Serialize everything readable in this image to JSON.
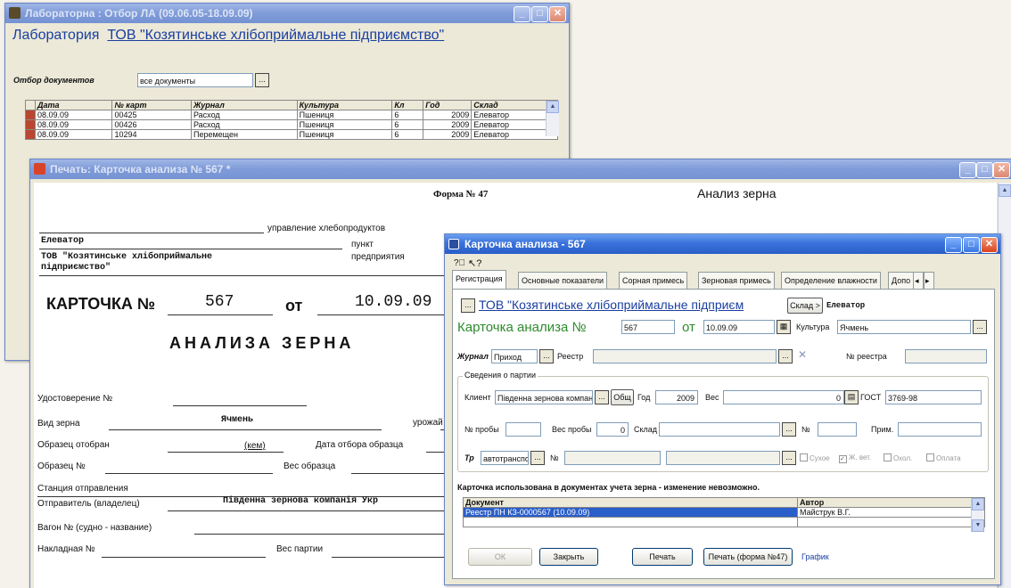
{
  "lab_window": {
    "title": "Лабораторна : Отбор ЛА (09.06.05-18.09.09)",
    "heading_prefix": "Лаборатория",
    "heading_company": "ТОВ \"Козятинське хлібоприймальне підприємство\"",
    "filter_label": "Отбор документов",
    "filter_value": "все документы",
    "table": {
      "columns": [
        "Дата",
        "№ карт",
        "Журнал",
        "Культура",
        "Кл",
        "Год",
        "Склад"
      ],
      "rows": [
        [
          "08.09.09",
          "00425",
          "Расход",
          "Пшениця",
          "6",
          "2009",
          "Елеватор"
        ],
        [
          "08.09.09",
          "00426",
          "Расход",
          "Пшениця",
          "6",
          "2009",
          "Елеватор"
        ],
        [
          "08.09.09",
          "10294",
          "Перемещен",
          "Пшениця",
          "6",
          "2009",
          "Елеватор"
        ]
      ]
    }
  },
  "print_window": {
    "title": "Печать: Карточка анализа № 567  *",
    "form_number": "Форма № 47",
    "form_title": "Анализ зерна",
    "upravlenie": "управление хлебопродуктов",
    "elevator": "Елеватор",
    "punkt": "пункт",
    "company": "ТОВ \"Козятинське хлібоприймальне підприємство\"",
    "predpriyatiya": "предприятия",
    "card_label": "КАРТОЧКА №",
    "card_number": "567",
    "ot": "от",
    "card_date": "10.09.09",
    "analysis_title": "АНАЛИЗА   ЗЕРНА",
    "udostoverenie": "Удостоверение №",
    "vid_zerna": "Вид зерна",
    "vid_zerna_value": "Ячмень",
    "urozhay": "урожай",
    "obrazec_otobran": "Образец отобран",
    "kem": "(кем)",
    "data_otbora": "Дата отбора образца",
    "obrazec_num": "Образец №",
    "ves_obrazca": "Вес образца",
    "stanciya": "Станция отправления",
    "otpravitel": "Отправитель (владелец)",
    "otpravitel_value": "Південна зернова компанія Укр",
    "vagon": "Вагон № (судно - название)",
    "nakladnaya": "Накладная №",
    "ves_partii": "Вес партии"
  },
  "card_window": {
    "title": "Карточка анализа - 567",
    "tabs": [
      "Регистрация",
      "Основные показатели",
      "Сорная примесь",
      "Зерновая примесь",
      "Определение влажности",
      "Допо"
    ],
    "company": "ТОВ \"Козятинське хлібоприймальне підприєм",
    "sklad_btn": "Склад >",
    "sklad_value": "Елеватор",
    "card_label": "Карточка анализа №",
    "card_number": "567",
    "ot": "от",
    "date_value": "10.09.09",
    "kultura_label": "Культура",
    "kultura_value": "Ячмень",
    "zhurnal_label": "Журнал",
    "zhurnal_value": "Приход",
    "reestr_label": "Реестр",
    "nomer_reestra_label": "№ реестра",
    "group_label": "Сведения о партии",
    "klient_label": "Клиент",
    "klient_value": "Південна зернова компан",
    "obsch_btn": "Общ",
    "god_label": "Год",
    "god_value": "2009",
    "ves_label": "Вес",
    "ves_value": "0",
    "gost_label": "ГОСТ",
    "gost_value": "3769-98",
    "nomer_proby": "№ пробы",
    "ves_proby": "Вес пробы",
    "ves_proby_value": "0",
    "sklad_label": "Склад",
    "nomer_label": "№",
    "prim_label": "Прим.",
    "tr_label": "Тр",
    "tr_value": "автотранспо",
    "nomer2_label": "№",
    "checkboxes": [
      "Сухое",
      "Ж. вет.",
      "Охол.",
      "Оплата"
    ],
    "notice": "Карточка использована в документах учета зерна - изменение невозможно.",
    "doc_table": {
      "columns": [
        "Документ",
        "Автор"
      ],
      "rows": [
        [
          "Реестр ПН КЗ-0000567 (10.09.09)",
          "Майструк В.Г."
        ]
      ]
    },
    "buttons": {
      "ok": "ОК",
      "close": "Закрыть",
      "print": "Печать",
      "print47": "Печать (форма №47)",
      "graph": "График"
    }
  },
  "colors": {
    "green": "#2e8b2e",
    "link": "#1a3ea0",
    "select": "#2a5ec8"
  }
}
